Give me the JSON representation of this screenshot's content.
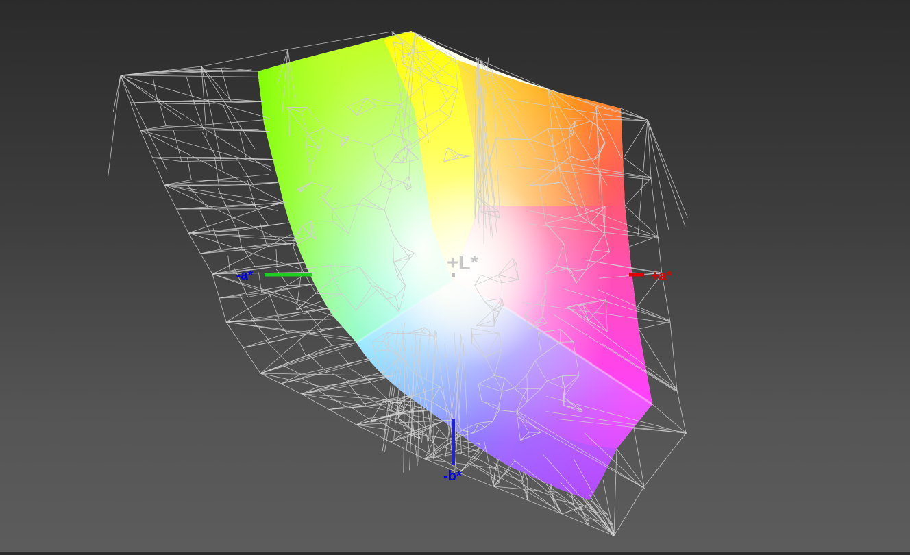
{
  "axes": {
    "l_plus": {
      "label": "+L*",
      "color": "#c8c8c8"
    },
    "a_plus": {
      "label": "+a*",
      "color": "#e00000"
    },
    "a_minus": {
      "label": "-a*",
      "color": "#0000e0",
      "line_color": "#22cc22"
    },
    "b_minus": {
      "label": "-b*",
      "color": "#0000e0",
      "line_color": "#2222dd"
    }
  },
  "colors": {
    "background_top": "#2b2b2b",
    "background_bottom": "#5c5c5c",
    "wireframe": "#d0d0d0",
    "gamut_yellow": "#ffff00",
    "gamut_green": "#80ff00",
    "gamut_orange": "#ff8a1e",
    "gamut_red": "#ff3a5a",
    "gamut_magenta": "#ff40ff",
    "gamut_violet": "#8a4cff",
    "gamut_cyan": "#40ffff",
    "gamut_white": "#ffffff"
  }
}
